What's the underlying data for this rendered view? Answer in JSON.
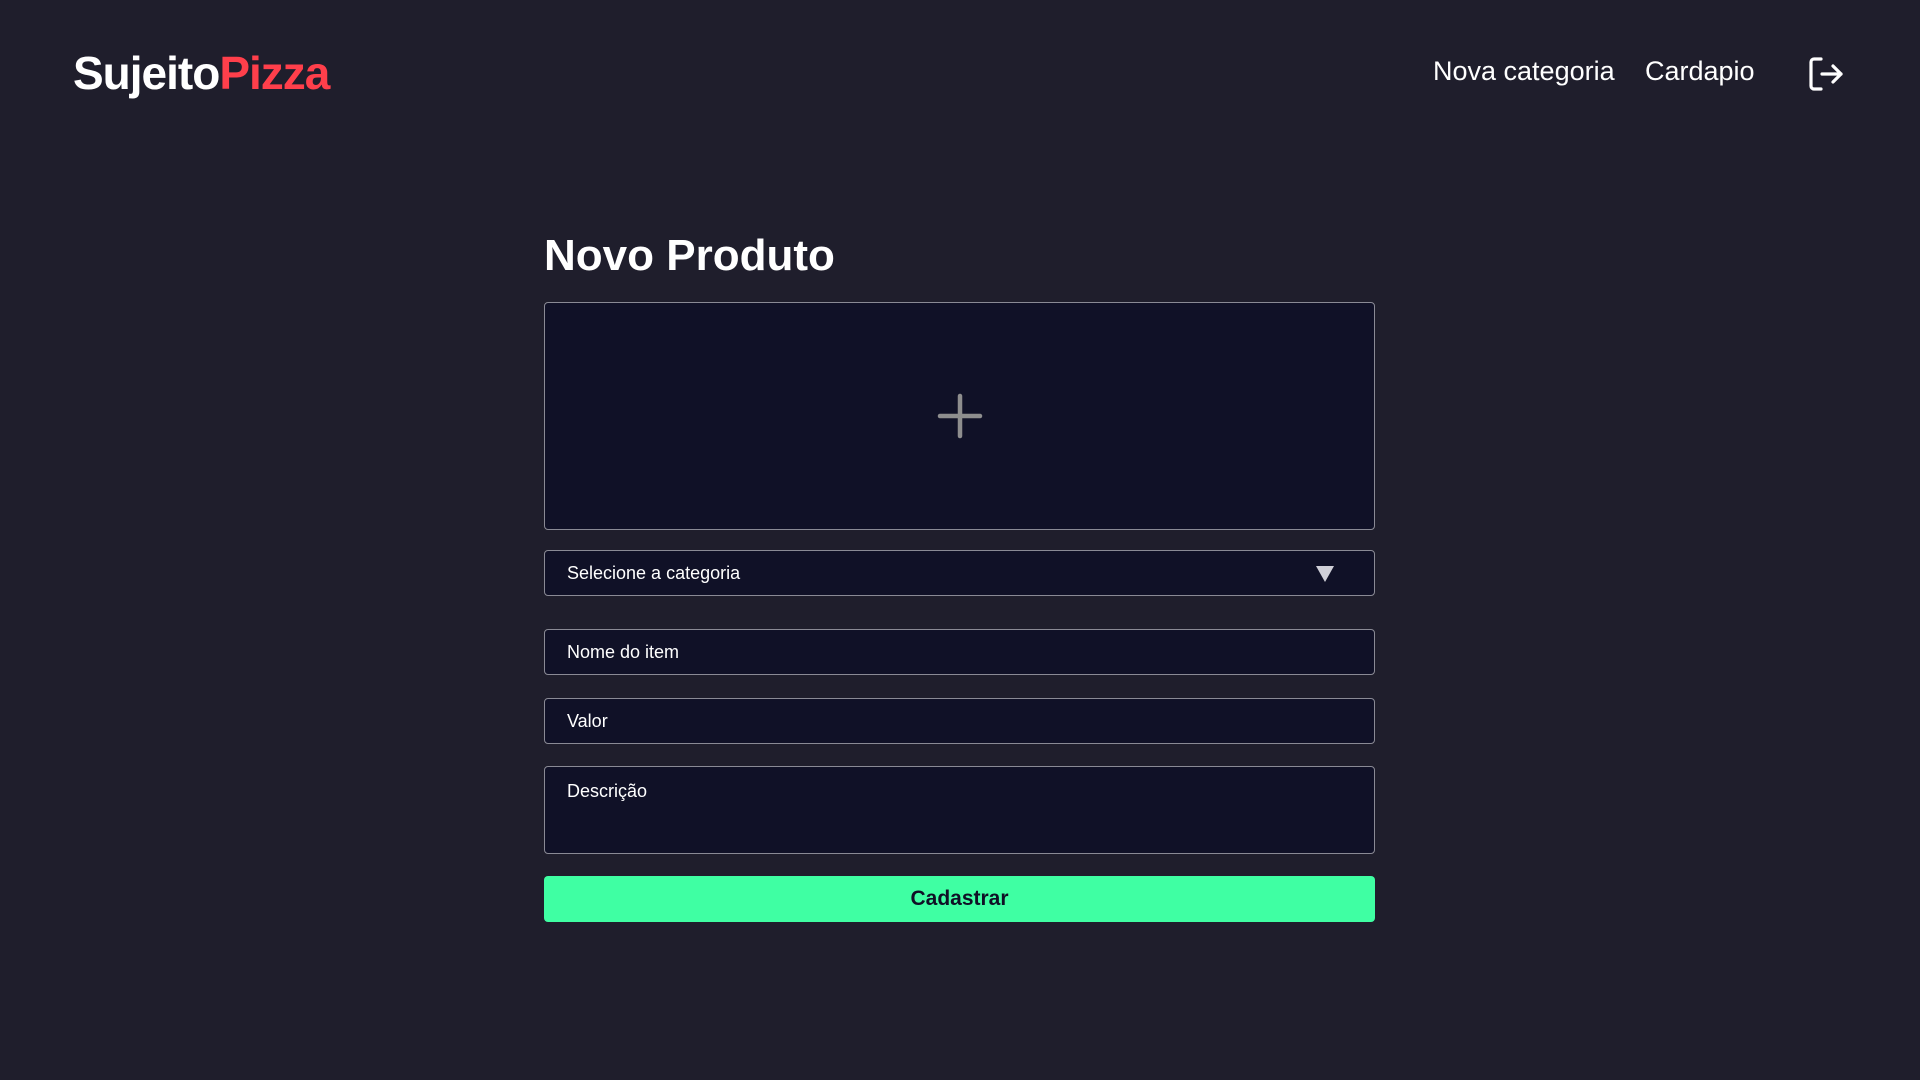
{
  "header": {
    "logo_part_a": "Sujeito",
    "logo_part_b": "Pizza",
    "nav": [
      {
        "label": "Nova categoria"
      },
      {
        "label": "Cardapio"
      }
    ],
    "logout_icon": "logout-icon"
  },
  "main": {
    "title": "Novo Produto",
    "upload_icon": "plus-icon",
    "category_select": {
      "selected": "Selecione a categoria"
    },
    "name_input": {
      "placeholder": "Nome do item",
      "value": ""
    },
    "price_input": {
      "placeholder": "Valor",
      "value": ""
    },
    "description_input": {
      "placeholder": "Descrição",
      "value": ""
    },
    "submit_label": "Cadastrar"
  },
  "colors": {
    "background": "#1f1e2c",
    "input_background": "#101127",
    "accent_red": "#ff3f4b",
    "accent_green": "#3fffa3"
  }
}
